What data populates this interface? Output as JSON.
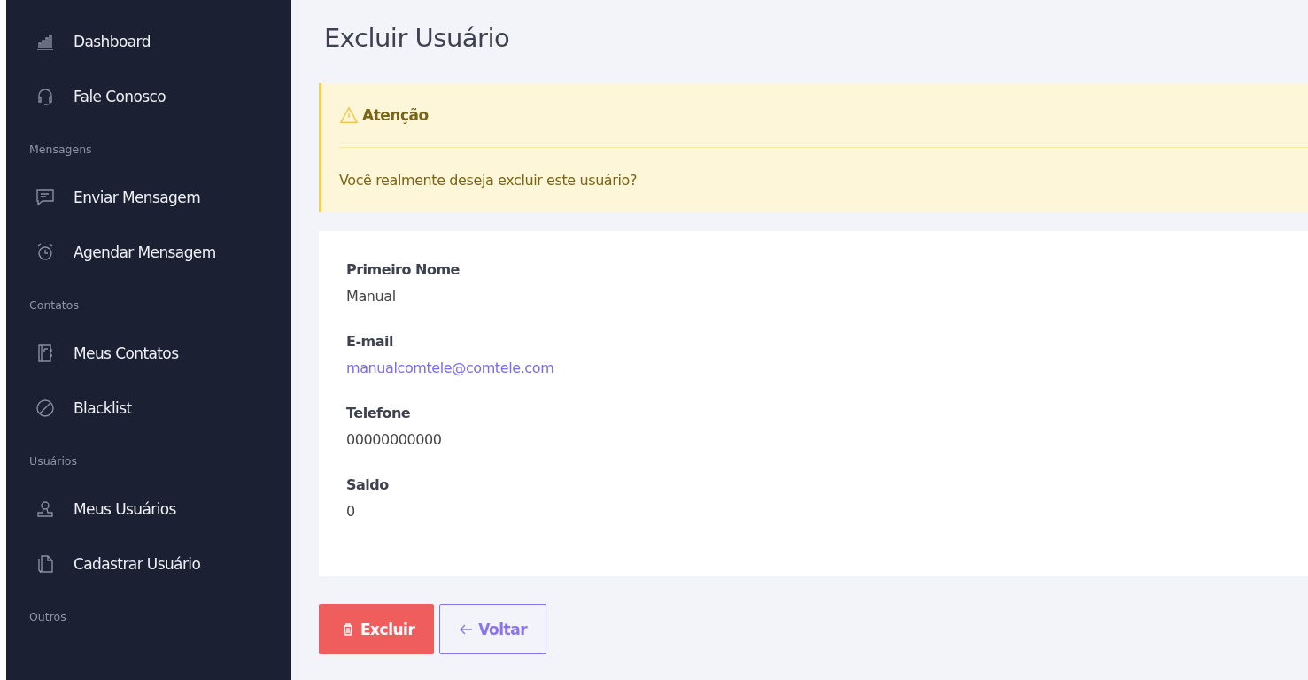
{
  "sidebar": {
    "sections": [
      {
        "items": [
          {
            "label": "Dashboard"
          },
          {
            "label": "Fale Conosco"
          }
        ]
      },
      {
        "heading": "Mensagens",
        "items": [
          {
            "label": "Enviar Mensagem"
          },
          {
            "label": "Agendar Mensagem"
          }
        ]
      },
      {
        "heading": "Contatos",
        "items": [
          {
            "label": "Meus Contatos"
          },
          {
            "label": "Blacklist"
          }
        ]
      },
      {
        "heading": "Usuários",
        "items": [
          {
            "label": "Meus Usuários"
          },
          {
            "label": "Cadastrar Usuário"
          }
        ]
      },
      {
        "heading": "Outros"
      }
    ]
  },
  "page_title": "Excluir Usuário",
  "alert": {
    "title": "Atenção",
    "message": "Você realmente deseja excluir este usuário?"
  },
  "fields": [
    {
      "label": "Primeiro Nome",
      "value": "Manual",
      "kind": "text"
    },
    {
      "label": "E-mail",
      "value": "manualcomtele@comtele.com",
      "kind": "link"
    },
    {
      "label": "Telefone",
      "value": "00000000000",
      "kind": "text"
    },
    {
      "label": "Saldo",
      "value": "0",
      "kind": "text"
    }
  ],
  "buttons": [
    {
      "label": "Excluir",
      "kind": "danger"
    },
    {
      "label": "Voltar",
      "kind": "back"
    }
  ]
}
